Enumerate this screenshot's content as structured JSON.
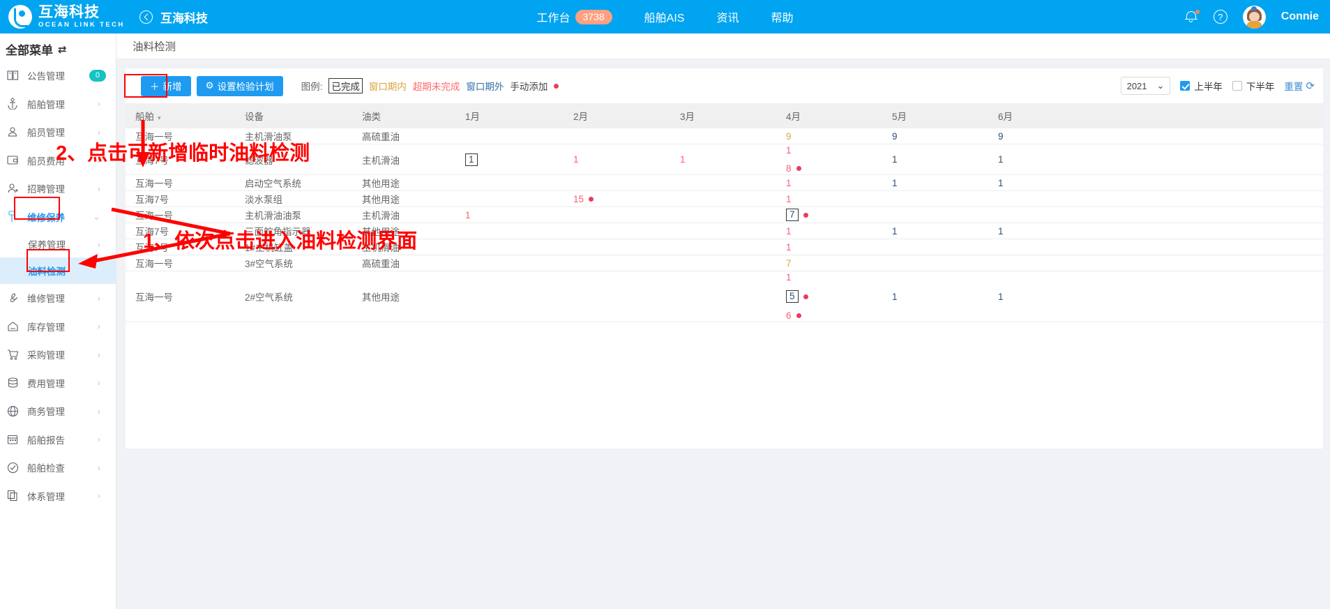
{
  "topbar": {
    "brand_cn": "互海科技",
    "brand_en": "OCEAN LINK TECH",
    "back_label": "互海科技",
    "nav": [
      {
        "label": "工作台",
        "badge": "3738"
      },
      {
        "label": "船舶AIS",
        "badge": ""
      },
      {
        "label": "资讯",
        "badge": ""
      },
      {
        "label": "帮助",
        "badge": ""
      }
    ],
    "bell_icon": "bell-icon",
    "help_icon": "help-icon",
    "username": "Connie"
  },
  "sidebar": {
    "title": "全部菜单",
    "swap_icon": "⇄",
    "items": [
      {
        "label": "公告管理",
        "icon": "announcement-icon",
        "badge": "0",
        "chevron": "",
        "kind": "top"
      },
      {
        "label": "船舶管理",
        "icon": "anchor-icon",
        "badge": "",
        "chevron": "›",
        "kind": "top"
      },
      {
        "label": "船员管理",
        "icon": "user-icon",
        "badge": "",
        "chevron": "›",
        "kind": "top"
      },
      {
        "label": "船员费用",
        "icon": "wallet-icon",
        "badge": "",
        "chevron": "›",
        "kind": "top"
      },
      {
        "label": "招聘管理",
        "icon": "user-plus-icon",
        "badge": "",
        "chevron": "›",
        "kind": "top"
      },
      {
        "label": "维修保养",
        "icon": "wrench-icon",
        "badge": "",
        "chevron": "⌄",
        "kind": "parent-active"
      },
      {
        "label": "保养管理",
        "icon": "",
        "badge": "",
        "chevron": "›",
        "kind": "sub"
      },
      {
        "label": "油料检测",
        "icon": "",
        "badge": "",
        "chevron": "",
        "kind": "sub-selected"
      },
      {
        "label": "维修管理",
        "icon": "spanner-icon",
        "badge": "",
        "chevron": "›",
        "kind": "top"
      },
      {
        "label": "库存管理",
        "icon": "home-icon",
        "badge": "",
        "chevron": "›",
        "kind": "top"
      },
      {
        "label": "采购管理",
        "icon": "cart-icon",
        "badge": "",
        "chevron": "›",
        "kind": "top"
      },
      {
        "label": "费用管理",
        "icon": "database-icon",
        "badge": "",
        "chevron": "›",
        "kind": "top"
      },
      {
        "label": "商务管理",
        "icon": "globe-icon",
        "badge": "",
        "chevron": "›",
        "kind": "top"
      },
      {
        "label": "船舶报告",
        "icon": "calendar-icon",
        "badge": "",
        "chevron": "›",
        "kind": "top"
      },
      {
        "label": "船舶检查",
        "icon": "check-circle-icon",
        "badge": "",
        "chevron": "›",
        "kind": "top"
      },
      {
        "label": "体系管理",
        "icon": "docs-icon",
        "badge": "",
        "chevron": "›",
        "kind": "top"
      }
    ]
  },
  "page": {
    "title": "油料检测"
  },
  "toolbar": {
    "add_label": "新增",
    "add_icon": "plus-icon",
    "plan_label": "设置检验计划",
    "plan_icon": "gear-icon",
    "legend_label": "图例:",
    "legend_items": [
      {
        "text": "已完成",
        "style": "done"
      },
      {
        "text": "窗口期内",
        "style": "inwin"
      },
      {
        "text": "超期未完成",
        "style": "overdue"
      },
      {
        "text": "窗口期外",
        "style": "outwin"
      },
      {
        "text": "手动添加",
        "style": "manual"
      }
    ],
    "legend_dot": "manual-dot",
    "year": "2021",
    "chevron_icon": "chevron-down-icon",
    "first_half_label": "上半年",
    "first_half_checked": true,
    "second_half_label": "下半年",
    "second_half_checked": false,
    "reset_label": "重置",
    "reset_icon": "refresh-icon"
  },
  "table": {
    "columns": [
      "船舶",
      "设备",
      "油类",
      "1月",
      "2月",
      "3月",
      "4月",
      "5月",
      "6月"
    ],
    "sort_caret": "▾",
    "rows": [
      {
        "ship": "互海一号",
        "device": "主机滑油泵",
        "oil": "高硫重油",
        "m1": [],
        "m2": [],
        "m3": [],
        "m4": [
          {
            "v": "9",
            "style": "amber",
            "dot": false,
            "boxed": false
          }
        ],
        "m5": [
          {
            "v": "9",
            "style": "blue",
            "dot": false,
            "boxed": false
          }
        ],
        "m6": [
          {
            "v": "9",
            "style": "blue",
            "dot": false,
            "boxed": false
          }
        ]
      },
      {
        "ship": "互海7号",
        "device": "滤波器",
        "oil": "主机滑油",
        "m1": [
          {
            "v": "1",
            "style": "blue",
            "dot": false,
            "boxed": true
          }
        ],
        "m2": [
          {
            "v": "1",
            "style": "red",
            "dot": false,
            "boxed": false
          }
        ],
        "m3": [
          {
            "v": "1",
            "style": "red",
            "dot": false,
            "boxed": false
          }
        ],
        "m4": [
          {
            "v": "1",
            "style": "red",
            "dot": false,
            "boxed": false
          },
          {
            "v": "8",
            "style": "red",
            "dot": true,
            "boxed": false
          }
        ],
        "m5": [
          {
            "v": "1",
            "style": "blue",
            "dot": false,
            "boxed": false
          }
        ],
        "m6": [
          {
            "v": "1",
            "style": "blue",
            "dot": false,
            "boxed": false
          }
        ]
      },
      {
        "ship": "互海一号",
        "device": "启动空气系统",
        "oil": "其他用途",
        "m1": [],
        "m2": [],
        "m3": [],
        "m4": [
          {
            "v": "1",
            "style": "red",
            "dot": false,
            "boxed": false
          }
        ],
        "m5": [
          {
            "v": "1",
            "style": "blue",
            "dot": false,
            "boxed": false
          }
        ],
        "m6": [
          {
            "v": "1",
            "style": "blue",
            "dot": false,
            "boxed": false
          }
        ]
      },
      {
        "ship": "互海7号",
        "device": "淡水泵组",
        "oil": "其他用途",
        "m1": [],
        "m2": [
          {
            "v": "15",
            "style": "red",
            "dot": true,
            "boxed": false
          }
        ],
        "m3": [],
        "m4": [
          {
            "v": "1",
            "style": "red",
            "dot": false,
            "boxed": false
          }
        ],
        "m5": [],
        "m6": []
      },
      {
        "ship": "互海一号",
        "device": "主机滑油油泵",
        "oil": "主机滑油",
        "m1": [
          {
            "v": "1",
            "style": "red",
            "dot": false,
            "boxed": false
          }
        ],
        "m2": [],
        "m3": [],
        "m4": [
          {
            "v": "7",
            "style": "blue",
            "dot": true,
            "boxed": true
          }
        ],
        "m5": [],
        "m6": []
      },
      {
        "ship": "互海7号",
        "device": "三面舵角指示器",
        "oil": "其他用途",
        "m1": [],
        "m2": [],
        "m3": [],
        "m4": [
          {
            "v": "1",
            "style": "red",
            "dot": false,
            "boxed": false
          }
        ],
        "m5": [
          {
            "v": "1",
            "style": "blue",
            "dot": false,
            "boxed": false
          }
        ],
        "m6": [
          {
            "v": "1",
            "style": "blue",
            "dot": false,
            "boxed": false
          }
        ]
      },
      {
        "ship": "互海7号",
        "device": "1#主机缸盖",
        "oil": "主机滑油",
        "m1": [],
        "m2": [],
        "m3": [],
        "m4": [
          {
            "v": "1",
            "style": "red",
            "dot": false,
            "boxed": false
          }
        ],
        "m5": [],
        "m6": []
      },
      {
        "ship": "互海一号",
        "device": "3#空气系统",
        "oil": "高硫重油",
        "m1": [],
        "m2": [],
        "m3": [],
        "m4": [
          {
            "v": "7",
            "style": "amber",
            "dot": false,
            "boxed": false
          }
        ],
        "m5": [],
        "m6": []
      },
      {
        "ship": "互海一号",
        "device": "2#空气系统",
        "oil": "其他用途",
        "m1": [],
        "m2": [],
        "m3": [],
        "m4": [
          {
            "v": "1",
            "style": "red",
            "dot": false,
            "boxed": false
          },
          {
            "v": "5",
            "style": "blue",
            "dot": true,
            "boxed": true
          },
          {
            "v": "6",
            "style": "red",
            "dot": true,
            "boxed": false
          }
        ],
        "m5": [
          {
            "v": "1",
            "style": "blue",
            "dot": false,
            "boxed": false
          }
        ],
        "m6": [
          {
            "v": "1",
            "style": "blue",
            "dot": false,
            "boxed": false
          }
        ]
      }
    ]
  },
  "annotations": {
    "step1": "1、依次点击进入油料检测界面",
    "step2": "2、点击可新增临时油料检测",
    "color": "#FF0000"
  }
}
